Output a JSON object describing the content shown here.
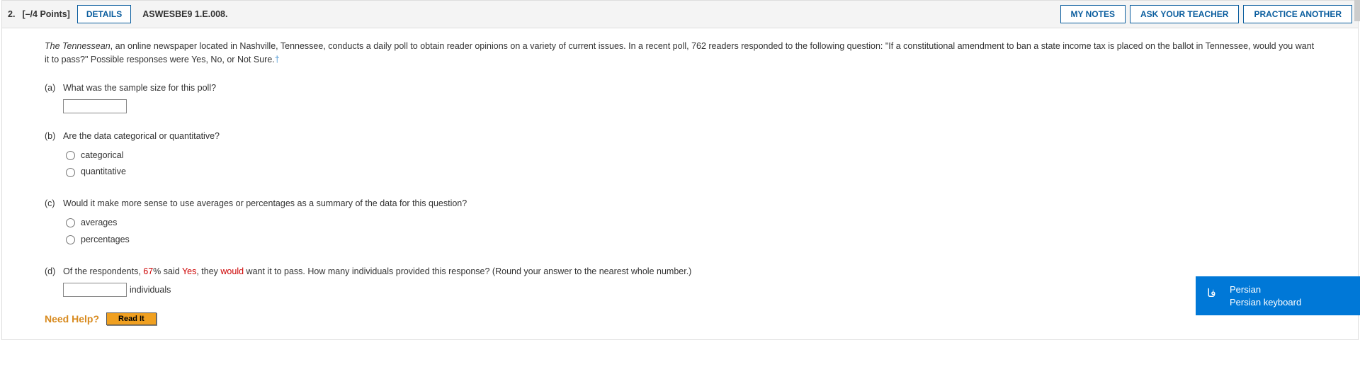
{
  "header": {
    "number": "2.",
    "points": "[–/4 Points]",
    "details": "DETAILS",
    "source": "ASWESBE9 1.E.008.",
    "buttons": {
      "notes": "MY NOTES",
      "ask": "ASK YOUR TEACHER",
      "practice": "PRACTICE ANOTHER"
    }
  },
  "intro": {
    "italic_lead": "The Tennessean",
    "rest": ", an online newspaper located in Nashville, Tennessee, conducts a daily poll to obtain reader opinions on a variety of current issues. In a recent poll, 762 readers responded to the following question: \"If a constitutional amendment to ban a state income tax is placed on the ballot in Tennessee, would you want it to pass?\" Possible responses were Yes, No, or Not Sure.",
    "dagger": "†"
  },
  "parts": {
    "a": {
      "label": "(a)",
      "text": "What was the sample size for this poll?"
    },
    "b": {
      "label": "(b)",
      "text": "Are the data categorical or quantitative?",
      "opt1": "categorical",
      "opt2": "quantitative"
    },
    "c": {
      "label": "(c)",
      "text": "Would it make more sense to use averages or percentages as a summary of the data for this question?",
      "opt1": "averages",
      "opt2": "percentages"
    },
    "d": {
      "label": "(d)",
      "pre": "Of the respondents, ",
      "pct": "67",
      "pct_suffix": "% said ",
      "yes": "Yes",
      "mid": ", they ",
      "would": "would",
      "post": " want it to pass. How many individuals provided this response? (Round your answer to the nearest whole number.)",
      "unit": "individuals"
    }
  },
  "help": {
    "label": "Need Help?",
    "read": "Read It"
  },
  "ime": {
    "glyph": "فا",
    "lang": "Persian",
    "kbd": "Persian keyboard"
  }
}
